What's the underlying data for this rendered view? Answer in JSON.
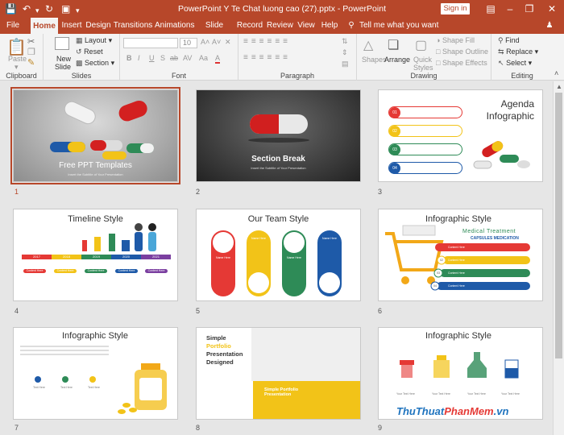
{
  "window": {
    "title": "PowerPoint Y Te Chat luong cao (27).pptx  -  PowerPoint",
    "sign_in": "Sign in"
  },
  "tabs": [
    "File",
    "Home",
    "Insert",
    "Design",
    "Transitions",
    "Animations",
    "Slide Show",
    "Record",
    "Review",
    "View",
    "Help"
  ],
  "tell_me": "Tell me what you want to do",
  "ribbon": {
    "clipboard": {
      "paste": "Paste",
      "label": "Clipboard"
    },
    "slides": {
      "new_slide": "New",
      "new_slide2": "Slide",
      "layout": "Layout",
      "reset": "Reset",
      "section": "Section",
      "label": "Slides"
    },
    "font": {
      "size": "10",
      "label": "Font",
      "buttons": [
        "B",
        "I",
        "U",
        "S",
        "ab",
        "AV",
        "Aa",
        "A"
      ]
    },
    "paragraph": {
      "label": "Paragraph"
    },
    "drawing": {
      "shapes": "Shapes",
      "arrange": "Arrange",
      "quick_styles": "Quick",
      "quick_styles2": "Styles",
      "shape_fill": "Shape Fill",
      "shape_outline": "Shape Outline",
      "shape_effects": "Shape Effects",
      "label": "Drawing"
    },
    "editing": {
      "find": "Find",
      "replace": "Replace",
      "select": "Select",
      "label": "Editing"
    }
  },
  "slides": [
    {
      "n": "1",
      "title": "Free  PPT Templates",
      "sub": "Insert the Subtitle of Your Presentation"
    },
    {
      "n": "2",
      "title": "Section Break",
      "sub": "Insert the Subtitle of Your Presentation"
    },
    {
      "n": "3",
      "title": "Agenda",
      "title2": "Infographic",
      "items": [
        "01",
        "02",
        "03",
        "04"
      ]
    },
    {
      "n": "4",
      "title": "Timeline Style",
      "years": [
        "2017",
        "2018",
        "2019",
        "2020",
        "2021"
      ],
      "label": "Content Here"
    },
    {
      "n": "5",
      "title": "Our Team Style",
      "name": "Name Here"
    },
    {
      "n": "6",
      "title": "Infographic Style",
      "heading": "Medical Treatment",
      "subheading": "CAPSULES MEDICATION",
      "label": "Content Here",
      "steps": [
        "01",
        "02",
        "03",
        "04"
      ]
    },
    {
      "n": "7",
      "title": "Infographic Style",
      "label": "Text Here"
    },
    {
      "n": "8",
      "line1": "Simple",
      "line2": "Portfolio",
      "line3": "Presentation",
      "line4": "Designed",
      "box_title": "Simple Portfolio",
      "box_title2": "Presentation"
    },
    {
      "n": "9",
      "title": "Infographic Style",
      "label": "Your Text Here"
    }
  ],
  "watermark": {
    "part1": "Thu",
    "part2": "Thuat",
    "part3": "PhanMem",
    "part4": ".vn"
  },
  "colors": {
    "accent": "#b7472a",
    "red": "#e53935",
    "yellow": "#f2c318",
    "green": "#2e8b57",
    "blue": "#1e5aa8"
  }
}
